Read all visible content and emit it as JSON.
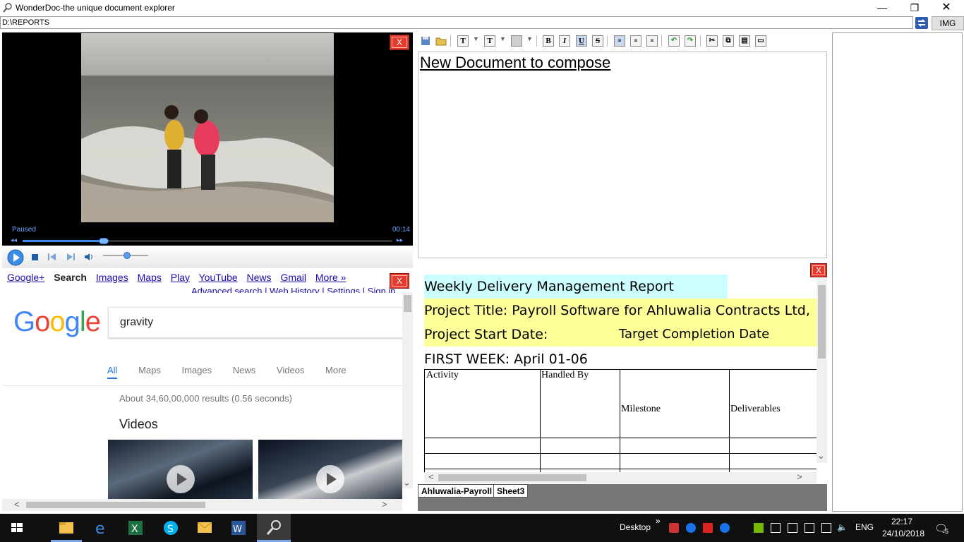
{
  "window": {
    "title": "WonderDoc-the unique document explorer",
    "minimize": "—",
    "restore": "❐",
    "close": "✕"
  },
  "address": {
    "path": "D:\\REPORTS",
    "img_button": "IMG"
  },
  "close_label": "X",
  "video": {
    "status": "Paused",
    "time": "00:14",
    "seek_progress": 0.22,
    "volume": 0.5
  },
  "google": {
    "nav": [
      "Google+",
      "Search",
      "Images",
      "Maps",
      "Play",
      "YouTube",
      "News",
      "Gmail",
      "More »"
    ],
    "sub_links": "Advanced search | Web History | Settings | Sign in",
    "logo": [
      "G",
      "o",
      "o",
      "g",
      "l",
      "e"
    ],
    "logo_colors": [
      "#4285f4",
      "#ea4335",
      "#fbbc05",
      "#4285f4",
      "#34a853",
      "#ea4335"
    ],
    "query": "gravity",
    "tabs": [
      "All",
      "Maps",
      "Images",
      "News",
      "Videos",
      "More"
    ],
    "results": "About 34,60,00,000 results (0.56 seconds)",
    "videos_heading": "Videos"
  },
  "editor": {
    "text": "New Document to compose"
  },
  "sheet": {
    "title": "Weekly Delivery Management Report",
    "project_title": "Project Title: Payroll Software for Ahluwalia Contracts Ltd,",
    "start_date_label": "Project Start Date:",
    "target_label": "Target Completion Date",
    "week": "FIRST WEEK: April 01-06",
    "headers": [
      "Activity",
      "Handled By",
      "Milestone",
      "Deliverables"
    ],
    "tabs": [
      "Ahluwalia-Payroll",
      "Sheet3"
    ],
    "colors": {
      "title_bg": "#ccffff",
      "project_bg": "#ffff99"
    }
  },
  "taskbar": {
    "desktop": "Desktop",
    "lang": "ENG",
    "time": "22:17",
    "date": "24/10/2018",
    "notifications": "5"
  }
}
